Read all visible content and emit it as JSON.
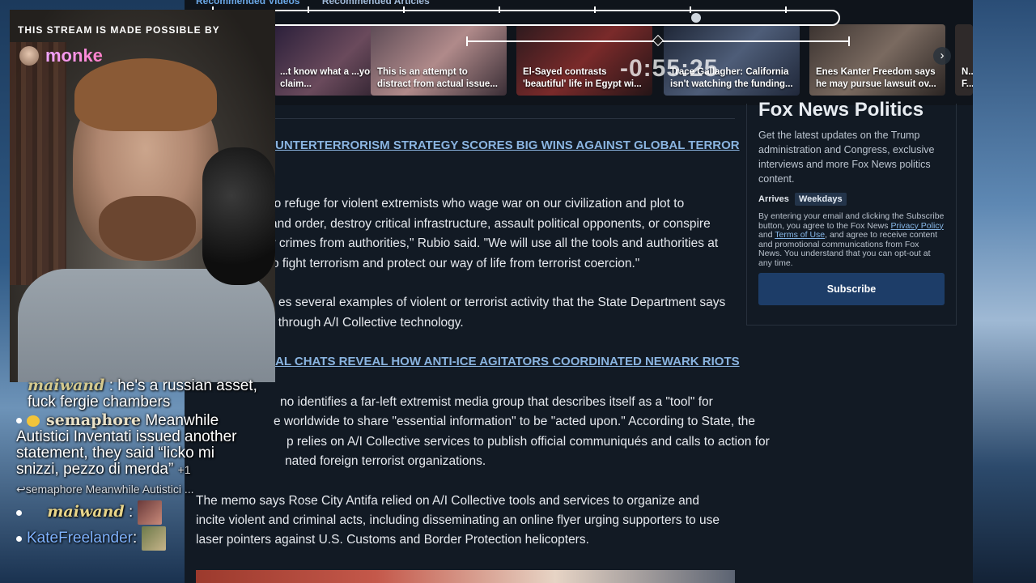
{
  "recommended": {
    "tabs": [
      "Recommended Videos",
      "Recommended Articles"
    ],
    "timecode": "-0:55:25",
    "cards": [
      {
        "caption": "...t know what a ...you can't claim...",
        "color": "#3b2a44"
      },
      {
        "caption": "This is an attempt to distract from actual issue...",
        "color": "#5a4650"
      },
      {
        "caption": "El-Sayed contrasts 'beautiful' life in Egypt wi...",
        "color": "#3a1e24"
      },
      {
        "caption": "Trace Gallagher: California isn't watching the funding...",
        "color": "#2a3346"
      },
      {
        "caption": "Enes Kanter Freedom says he may pursue lawsuit ov...",
        "color": "#3d3a36"
      },
      {
        "caption": "N... F...",
        "color": "#2f2a2a"
      }
    ]
  },
  "article": {
    "headline1": "UNTERTERRORISM STRATEGY SCORES BIG WINS AGAINST GLOBAL TERROR",
    "p1_l1": "no refuge for violent extremists who wage war on our civilization and plot to",
    "p1_l2": "y and order, destroy critical infrastructure, assault political opponents, or conspire",
    "p1_l3": "ir crimes from authorities,\" Rubio said. \"We will use all the tools and authorities at",
    "p1_l4": "o fight terrorism and protect our way of life from terrorist coercion.\"",
    "p2_l1": "es several examples of violent or terrorist activity that the State Department says",
    "p2_l2": "l through A/I Collective technology.",
    "headline2": "AL CHATS REVEAL HOW ANTI-ICE AGITATORS COORDINATED NEWARK RIOTS",
    "p3_l1": "no identifies a far-left extremist media group that describes itself as a \"tool\" for",
    "p3_l2": "e worldwide to share \"essential information\" to be \"acted upon.\" According to State, the",
    "p3_l3": "p relies on A/I Collective services to publish official communiqués and calls to action for",
    "p3_l4": "nated foreign terrorist organizations.",
    "p4_l1": "The memo says Rose City Antifa relied on A/I Collective tools and services to organize and",
    "p4_l2": "incite violent and criminal acts, including disseminating an online flyer urging supporters to use",
    "p4_l3": "laser pointers against U.S. Customs and Border Protection helicopters."
  },
  "newsletter": {
    "title": "Fox News Politics",
    "description": "Get the latest updates on the Trump administration and Congress, exclusive interviews and more Fox News politics content.",
    "arrives_label": "Arrives",
    "arrives_value": "Weekdays",
    "legal_1": "By entering your email and clicking the Subscribe button, you agree to the Fox News",
    "privacy_link": "Privacy Policy",
    "and": "and",
    "terms_link": "Terms of Use",
    "legal_2": ", and agree to receive content and promotional communications from Fox News. You understand that you can opt-out at any time.",
    "subscribe_label": "Subscribe"
  },
  "stream": {
    "sponsor_text": "THIS STREAM IS MADE POSSIBLE BY",
    "brand": "monke"
  },
  "chat": {
    "msg1_text": ": he's a russian asset, fuck fergie chambers",
    "msg1_user": "maiwand",
    "msg2_user": "semaphore",
    "msg2_text": "Meanwhile Autistici Inventati issued another statement, they said “licko mi snizzi, pezzo di merda”",
    "msg2_count": "+1",
    "reply_user": "semaphore",
    "reply_text": "Meanwhile Autistici ...",
    "msg3_user": "maiwand",
    "msg3_sep": ":",
    "msg4_user": "KateFreelander",
    "msg4_sep": ":"
  }
}
